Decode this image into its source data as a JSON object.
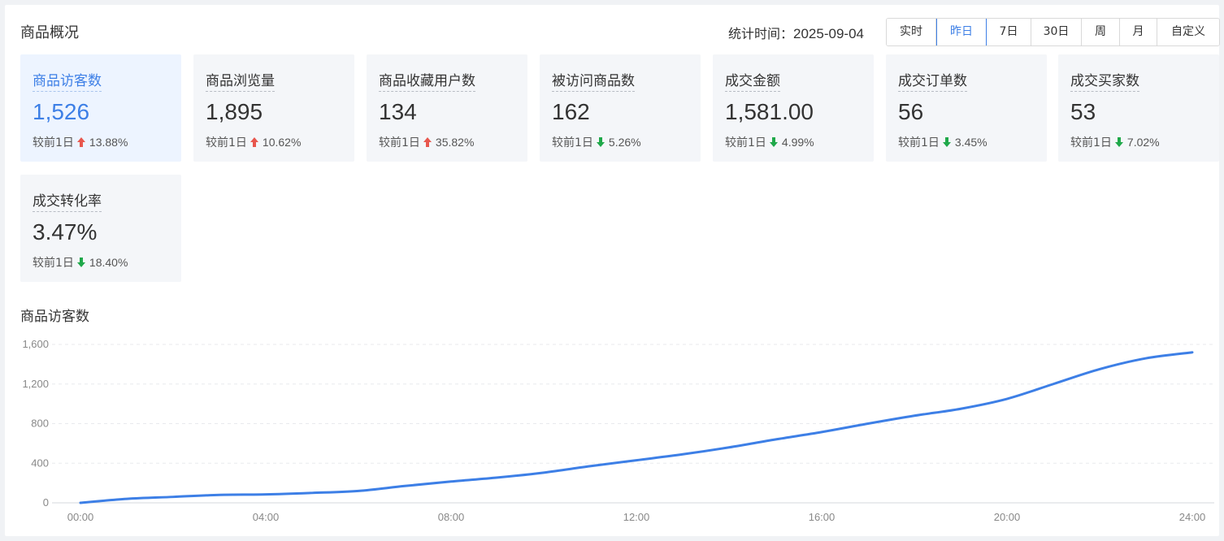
{
  "header": {
    "title": "商品概况",
    "stat_time_label": "统计时间：",
    "stat_time_value": "2025-09-04",
    "ranges": [
      "实时",
      "昨日",
      "7日",
      "30日",
      "周",
      "月",
      "自定义"
    ],
    "active_range": "昨日"
  },
  "compare_label": "较前1日",
  "colors": {
    "accent": "#3d7fe6",
    "up": "#e8574e",
    "down": "#1fa84a"
  },
  "metrics": [
    {
      "label": "商品访客数",
      "value": "1,526",
      "direction": "up",
      "change": "13.88%",
      "active": true
    },
    {
      "label": "商品浏览量",
      "value": "1,895",
      "direction": "up",
      "change": "10.62%"
    },
    {
      "label": "商品收藏用户数",
      "value": "134",
      "direction": "up",
      "change": "35.82%"
    },
    {
      "label": "被访问商品数",
      "value": "162",
      "direction": "down",
      "change": "5.26%"
    },
    {
      "label": "成交金额",
      "value": "1,581.00",
      "direction": "down",
      "change": "4.99%"
    },
    {
      "label": "成交订单数",
      "value": "56",
      "direction": "down",
      "change": "3.45%"
    },
    {
      "label": "成交买家数",
      "value": "53",
      "direction": "down",
      "change": "7.02%"
    },
    {
      "label": "成交转化率",
      "value": "3.47%",
      "direction": "down",
      "change": "18.40%"
    }
  ],
  "chart_title": "商品访客数",
  "chart_data": {
    "type": "line",
    "title": "商品访客数",
    "x_ticks": [
      "00:00",
      "04:00",
      "08:00",
      "12:00",
      "16:00",
      "20:00",
      "24:00"
    ],
    "y_ticks": [
      "0",
      "400",
      "800",
      "1,200",
      "1,600"
    ],
    "ylim": [
      0,
      1600
    ],
    "xlim": [
      0,
      24
    ],
    "grid": true,
    "series": [
      {
        "color": "#3d7fe6",
        "x": [
          0,
          1,
          2,
          3,
          4,
          5,
          6,
          7,
          8,
          9,
          10,
          11,
          12,
          13,
          14,
          15,
          16,
          17,
          18,
          19,
          20,
          21,
          22,
          23,
          24
        ],
        "y": [
          0,
          40,
          60,
          80,
          85,
          100,
          120,
          170,
          215,
          255,
          305,
          370,
          430,
          490,
          560,
          640,
          715,
          800,
          880,
          950,
          1050,
          1200,
          1350,
          1460,
          1520
        ]
      }
    ]
  }
}
